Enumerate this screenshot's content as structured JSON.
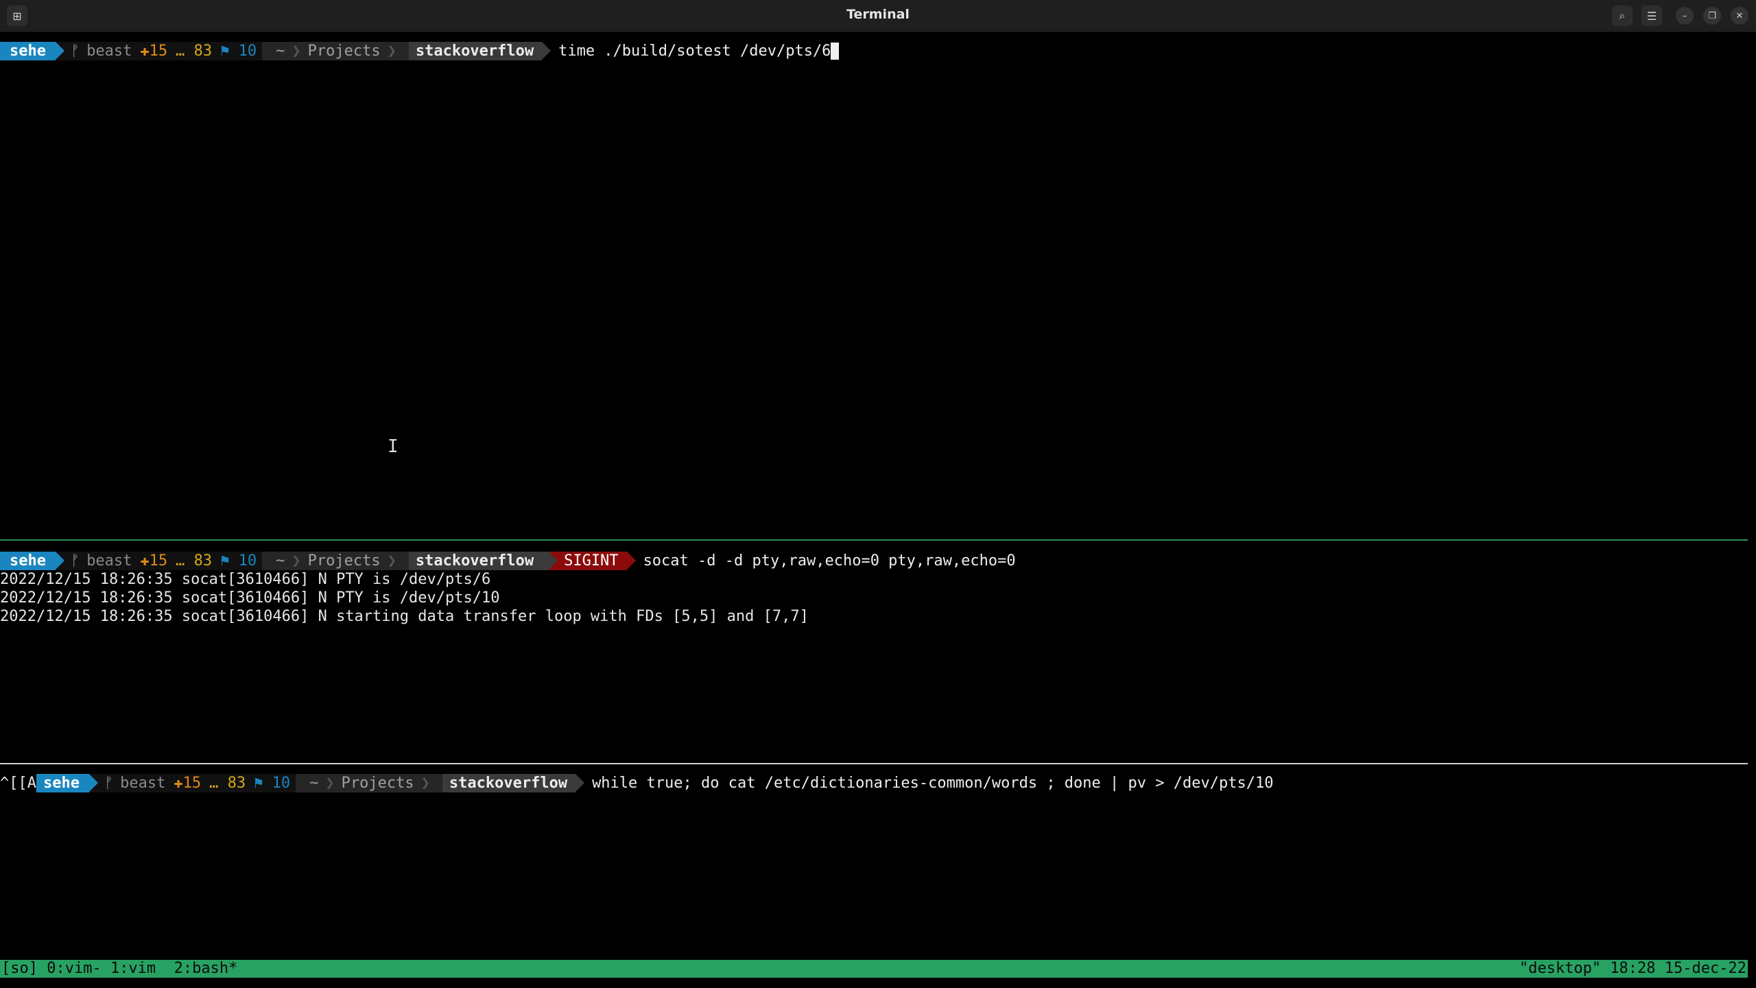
{
  "window": {
    "title": "Terminal"
  },
  "prompt": {
    "user": "sehe",
    "branch_icon": "ᚠ",
    "branch": "beast",
    "plus_symbol": "✚",
    "staged": "15",
    "ellipsis": "…",
    "untracked": "83",
    "flag_symbol": "⚑",
    "stashes": "10",
    "dir_home": "~",
    "dir_sep": "❯",
    "dir_projects": "Projects",
    "dir_current": "stackoverflow"
  },
  "pane1": {
    "command": "time ./build/sotest /dev/pts/6"
  },
  "pane2": {
    "signal": "SIGINT",
    "command": "socat -d -d pty,raw,echo=0 pty,raw,echo=0",
    "output": [
      "2022/12/15 18:26:35 socat[3610466] N PTY is /dev/pts/6",
      "2022/12/15 18:26:35 socat[3610466] N PTY is /dev/pts/10",
      "2022/12/15 18:26:35 socat[3610466] N starting data transfer loop with FDs [5,5] and [7,7]"
    ]
  },
  "pane3": {
    "prefix": "^[[A",
    "command": "while true; do cat /etc/dictionaries-common/words ; done | pv > /dev/pts/10"
  },
  "status_bar": {
    "left": "[so] 0:vim- 1:vim  2:bash*",
    "right": "\"desktop\" 18:28 15-dec-22"
  },
  "colors": {
    "user_bg": "#1a86c0",
    "sigint_bg": "#8b0b0b",
    "status_bg": "#28a263"
  }
}
